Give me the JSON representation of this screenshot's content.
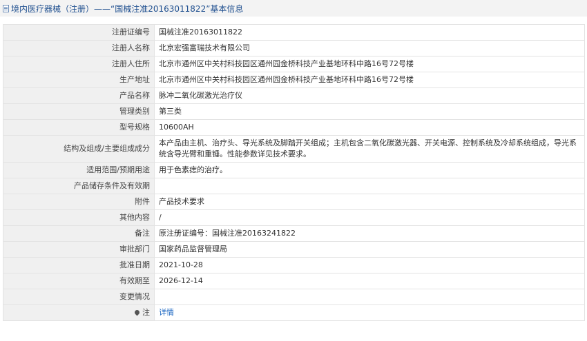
{
  "header": {
    "title": "境内医疗器械（注册）——“国械注准20163011822”基本信息"
  },
  "rows": [
    {
      "label": "注册证编号",
      "value": "国械注准20163011822"
    },
    {
      "label": "注册人名称",
      "value": "北京宏强富瑞技术有限公司"
    },
    {
      "label": "注册人住所",
      "value": "北京市通州区中关村科技园区通州园金桥科技产业基地环科中路16号72号楼"
    },
    {
      "label": "生产地址",
      "value": "北京市通州区中关村科技园区通州园金桥科技产业基地环科中路16号72号楼"
    },
    {
      "label": "产品名称",
      "value": "脉冲二氧化碳激光治疗仪"
    },
    {
      "label": "管理类别",
      "value": "第三类"
    },
    {
      "label": "型号规格",
      "value": "10600AH"
    },
    {
      "label": "结构及组成/主要组成成分",
      "value": "本产品由主机、治疗头、导光系统及脚踏开关组成；主机包含二氧化碳激光器、开关电源、控制系统及冷却系统组成，导光系统含导光臂和重锤。性能参数详见技术要求。"
    },
    {
      "label": "适用范围/预期用途",
      "value": "用于色素痣的治疗。"
    },
    {
      "label": "产品储存条件及有效期",
      "value": ""
    },
    {
      "label": "附件",
      "value": "产品技术要求"
    },
    {
      "label": "其他内容",
      "value": "/"
    },
    {
      "label": "备注",
      "value": "原注册证编号：国械注准20163241822"
    },
    {
      "label": "审批部门",
      "value": "国家药品监督管理局"
    },
    {
      "label": "批准日期",
      "value": "2021-10-28"
    },
    {
      "label": "有效期至",
      "value": "2026-12-14"
    },
    {
      "label": "变更情况",
      "value": ""
    }
  ],
  "note": {
    "label": "注",
    "link_text": "详情",
    "icon": "pin-icon"
  }
}
